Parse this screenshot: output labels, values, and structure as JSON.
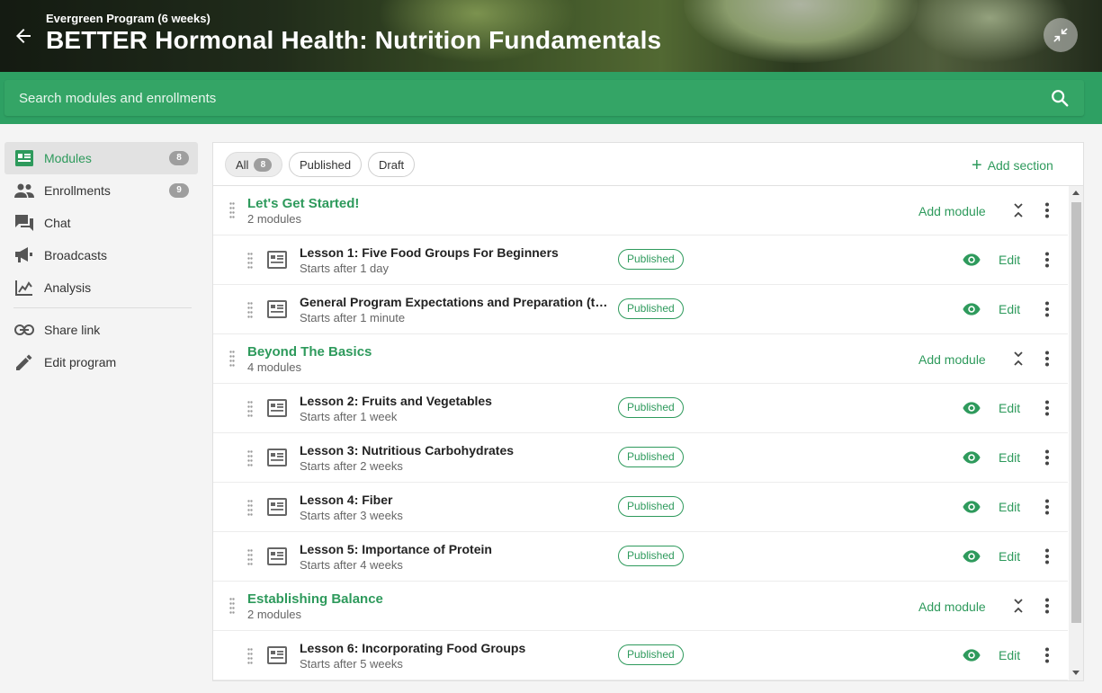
{
  "header": {
    "subtitle": "Evergreen Program (6 weeks)",
    "title": "BETTER Hormonal Health: Nutrition Fundamentals"
  },
  "search": {
    "placeholder": "Search modules and enrollments"
  },
  "sidebar": {
    "items": [
      {
        "label": "Modules",
        "count": "8",
        "icon": "modules-icon"
      },
      {
        "label": "Enrollments",
        "count": "9",
        "icon": "people-icon"
      },
      {
        "label": "Chat",
        "icon": "chat-icon"
      },
      {
        "label": "Broadcasts",
        "icon": "megaphone-icon"
      },
      {
        "label": "Analysis",
        "icon": "analysis-icon"
      },
      {
        "label": "Share link",
        "icon": "link-icon"
      },
      {
        "label": "Edit program",
        "icon": "pencil-icon"
      }
    ]
  },
  "filters": {
    "all_label": "All",
    "all_count": "8",
    "published_label": "Published",
    "draft_label": "Draft",
    "add_section_label": "Add section"
  },
  "sections": [
    {
      "title": "Let's Get Started!",
      "subtitle": "2 modules",
      "add_module_label": "Add module",
      "modules": [
        {
          "title": "Lesson 1: Five Food Groups For Beginners",
          "subtitle": "Starts after 1 day",
          "status": "Published",
          "edit_label": "Edit"
        },
        {
          "title": "General Program Expectations and Preparation (tips, …",
          "subtitle": "Starts after 1 minute",
          "status": "Published",
          "edit_label": "Edit"
        }
      ]
    },
    {
      "title": "Beyond The Basics",
      "subtitle": "4 modules",
      "add_module_label": "Add module",
      "modules": [
        {
          "title": "Lesson 2: Fruits and Vegetables",
          "subtitle": "Starts after 1 week",
          "status": "Published",
          "edit_label": "Edit"
        },
        {
          "title": "Lesson 3: Nutritious Carbohydrates",
          "subtitle": "Starts after 2 weeks",
          "status": "Published",
          "edit_label": "Edit"
        },
        {
          "title": "Lesson 4: Fiber",
          "subtitle": "Starts after 3 weeks",
          "status": "Published",
          "edit_label": "Edit"
        },
        {
          "title": "Lesson 5: Importance of Protein",
          "subtitle": "Starts after 4 weeks",
          "status": "Published",
          "edit_label": "Edit"
        }
      ]
    },
    {
      "title": "Establishing Balance",
      "subtitle": "2 modules",
      "add_module_label": "Add module",
      "modules": [
        {
          "title": "Lesson 6: Incorporating Food Groups",
          "subtitle": "Starts after 5 weeks",
          "status": "Published",
          "edit_label": "Edit"
        }
      ]
    }
  ],
  "colors": {
    "accent": "#2e9a5c",
    "search_band": "#2ea063",
    "badge_gray": "#9e9e9e"
  }
}
